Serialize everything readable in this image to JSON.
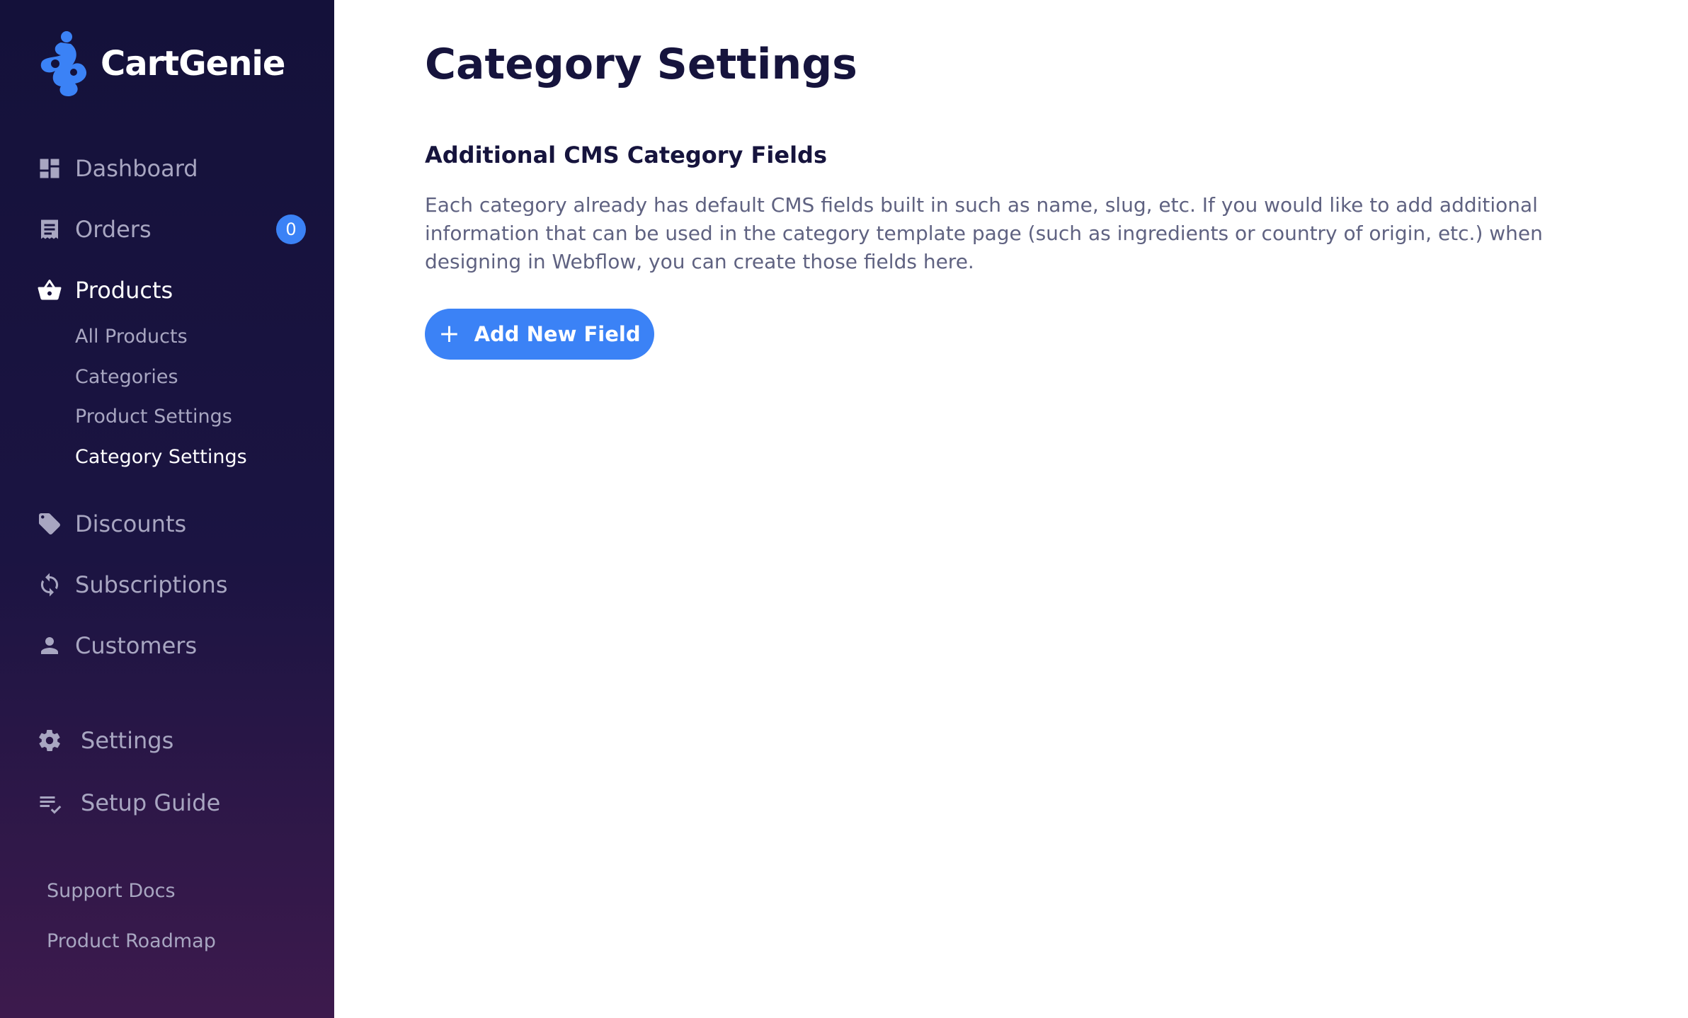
{
  "brand": {
    "name": "CartGenie",
    "accent": "#3b82f6"
  },
  "sidebar": {
    "nav": [
      {
        "label": "Dashboard",
        "icon": "dashboard-icon"
      },
      {
        "label": "Orders",
        "icon": "orders-icon",
        "badge": "0"
      },
      {
        "label": "Products",
        "icon": "basket-icon",
        "active": true
      },
      {
        "label": "Discounts",
        "icon": "tag-icon"
      },
      {
        "label": "Subscriptions",
        "icon": "sync-icon"
      },
      {
        "label": "Customers",
        "icon": "person-icon"
      }
    ],
    "products_sub": [
      {
        "label": "All Products"
      },
      {
        "label": "Categories"
      },
      {
        "label": "Product Settings"
      },
      {
        "label": "Category Settings",
        "active": true
      }
    ],
    "lower": [
      {
        "label": "Settings",
        "icon": "gear-icon"
      },
      {
        "label": "Setup Guide",
        "icon": "checklist-icon"
      }
    ],
    "footer": [
      {
        "label": "Support Docs"
      },
      {
        "label": "Product Roadmap"
      }
    ]
  },
  "main": {
    "title": "Category Settings",
    "section": {
      "title": "Additional CMS Category Fields",
      "description": "Each category already has default CMS fields built in such as name, slug, etc. If you would like to add additional information that can be used in the category template page (such as ingredients or country of origin, etc.) when designing in Webflow, you can create those fields here."
    },
    "add_button": {
      "icon": "+",
      "label": "Add New Field"
    }
  }
}
